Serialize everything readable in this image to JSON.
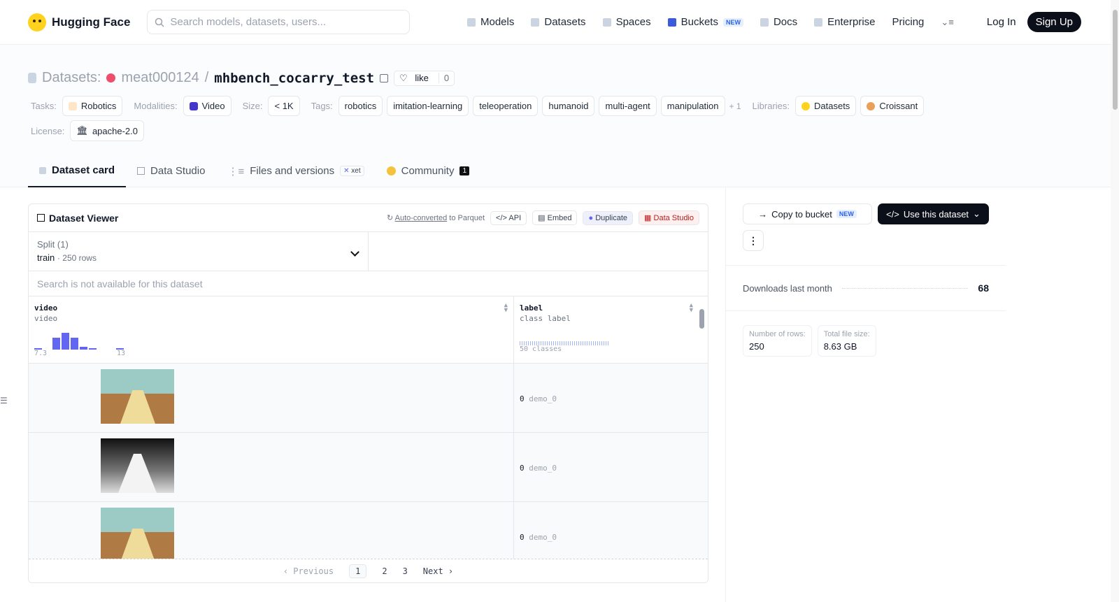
{
  "topbar": {
    "brand": "Hugging Face",
    "search_placeholder": "Search models, datasets, users...",
    "nav": [
      {
        "label": "Models",
        "icon": "cube-icon"
      },
      {
        "label": "Datasets",
        "icon": "database-icon"
      },
      {
        "label": "Spaces",
        "icon": "grid-icon"
      },
      {
        "label": "Buckets",
        "icon": "bucket-icon",
        "badge": "NEW"
      },
      {
        "label": "Docs",
        "icon": "book-icon"
      },
      {
        "label": "Enterprise",
        "icon": "briefcase-icon"
      },
      {
        "label": "Pricing"
      }
    ],
    "login": "Log In",
    "signup": "Sign Up"
  },
  "repo": {
    "type_label": "Datasets:",
    "owner": "meat000124",
    "separator": "/",
    "name": "mhbench_cocarry_test",
    "like_label": "like",
    "like_count": "0"
  },
  "meta": {
    "tasks_label": "Tasks:",
    "task": "Robotics",
    "modalities_label": "Modalities:",
    "modality": "Video",
    "size_label": "Size:",
    "size": "< 1K",
    "tags_label": "Tags:",
    "tags": [
      "robotics",
      "imitation-learning",
      "teleoperation",
      "humanoid",
      "multi-agent",
      "manipulation"
    ],
    "more_tags": "+ 1",
    "libraries_label": "Libraries:",
    "libraries": [
      "Datasets",
      "Croissant"
    ],
    "license_label": "License:",
    "license": "apache-2.0"
  },
  "tabs": {
    "card": "Dataset card",
    "studio": "Data Studio",
    "files": "Files and versions",
    "xet": "xet",
    "community": "Community",
    "community_count": "1"
  },
  "viewer": {
    "title": "Dataset Viewer",
    "auto_converted": "Auto-converted",
    "to_parquet": "to Parquet",
    "api": "API",
    "embed": "Embed",
    "duplicate": "Duplicate",
    "data_studio": "Data Studio",
    "split_label": "Split (1)",
    "split_name": "train",
    "split_rows": "250 rows",
    "search_disabled": "Search is not available for this dataset",
    "col1_name": "video",
    "col1_type": "video",
    "col1_min": "7.3",
    "col1_max": "13",
    "col1_hist": [
      0.05,
      0,
      0.6,
      0.85,
      0.6,
      0.15,
      0.05,
      0,
      0,
      0.05
    ],
    "col2_name": "label",
    "col2_type": "class label",
    "col2_classes": "50 classes",
    "rows": [
      {
        "thumb": "color",
        "label_id": "0",
        "label_name": "demo_0"
      },
      {
        "thumb": "depth",
        "label_id": "0",
        "label_name": "demo_0"
      },
      {
        "thumb": "color",
        "label_id": "0",
        "label_name": "demo_0"
      }
    ],
    "pager": {
      "prev": "Previous",
      "pages": [
        "1",
        "2",
        "3"
      ],
      "next": "Next"
    }
  },
  "sidebar": {
    "copy_bucket": "Copy to bucket",
    "copy_badge": "NEW",
    "use_dataset": "Use this dataset",
    "downloads_label": "Downloads last month",
    "downloads": "68",
    "rows_label": "Number of rows:",
    "rows_value": "250",
    "size_label": "Total file size:",
    "size_value": "8.63 GB"
  }
}
